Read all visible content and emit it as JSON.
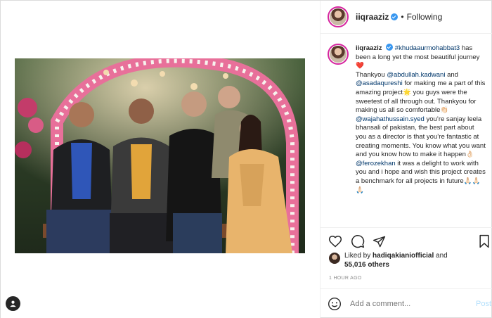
{
  "post": {
    "username": "iiqraaziz",
    "follow_state": "Following",
    "separator": "•"
  },
  "caption": {
    "username": "iiqraaziz",
    "hashtag": "#khudaaurmohabbat3",
    "p1": " has been a long yet the most beautiful journey❤️",
    "p2a": "Thankyou ",
    "mention1": "@abdullah.kadwani",
    "p2b": " and ",
    "mention2": "@asadaqureshi",
    "p2c": " for making me a part of this amazing project🌟 you guys were the sweetest of all through out. Thankyou for making us all so comfortable👏🏻",
    "mention3": "@wajahathussain.syed",
    "p3": " you’re sanjay leela bhansali of pakistan, the best part about you as a director is that you’re fantastic at creating moments. You know what you want and you know how to make it happen👌🏻",
    "mention4": "@ferozekhan",
    "p4": " it was a delight to work with you and i hope and wish this project creates a benchmark for all projects in future🙏🏻🙏🏻🙏🏻"
  },
  "likes": {
    "prefix": "Liked by ",
    "user": "hadiqakianiofficial",
    "mid": " and",
    "count": "55,016 others"
  },
  "time_ago": "1 HOUR AGO",
  "comment": {
    "placeholder": "Add a comment...",
    "post_label": "Post"
  },
  "colors": {
    "verified": "#3897f0",
    "mention": "#00376b",
    "post_disabled": "#b2dffc"
  },
  "icons": [
    "verified-badge-icon",
    "heart-icon",
    "comment-icon",
    "share-icon",
    "bookmark-icon",
    "emoji-icon",
    "user-tag-icon"
  ]
}
